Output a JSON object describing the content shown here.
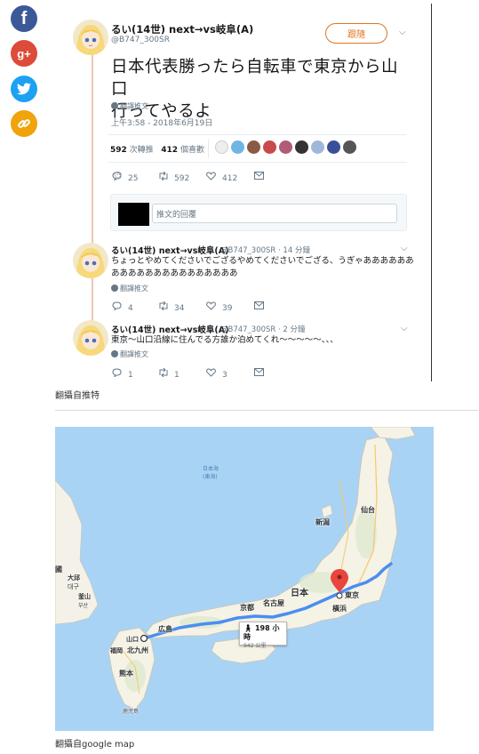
{
  "share": {
    "facebook_label": "f",
    "googleplus_label": "g+"
  },
  "tweet": {
    "display_name": "るい(14世) next→vs岐阜(A)",
    "handle": "@B747_300SR",
    "follow_label": "跟隨",
    "text_line1": "日本代表勝ったら自転車で東京から山口",
    "text_line2": "行ってやるよ",
    "translate_label": "翻譯推文",
    "timestamp": "上午3:58 - 2018年6月19日",
    "retweets_count": "592",
    "retweets_label": "次轉推",
    "likes_count": "412",
    "likes_label": "個喜歡",
    "reply_count": "25",
    "retweet_action_count": "592",
    "like_action_count": "412",
    "reply_placeholder": "推文的回覆"
  },
  "replies": [
    {
      "display_name": "るい(14世) next→vs岐阜(A)",
      "handle_time": "@B747_300SR · 14 分鐘",
      "text": "ちょっとやめてくださいでござるやめてくださいでござる、うぎゃあああああああああああああああああああああ",
      "translate_label": "翻譯推文",
      "reply_count": "4",
      "retweet_count": "34",
      "like_count": "39"
    },
    {
      "display_name": "るい(14世) next→vs岐阜(A)",
      "handle_time": "@B747_300SR · 2 分鐘",
      "text": "東京～山口沿線に住んでる方誰か泊めてくれ～～～～～、、、",
      "translate_label": "翻譯推文",
      "reply_count": "1",
      "retweet_count": "1",
      "like_count": "3"
    }
  ],
  "captions": {
    "twitter": "翻攝自推特",
    "map": "翻攝自google map"
  },
  "map": {
    "sea_jp": "日本海",
    "sea_kr": "(東海)",
    "korea": "國",
    "daegu": "大邱",
    "daegu_kr": "대구",
    "busan": "釜山",
    "busan_kr": "부산",
    "japan": "日本",
    "sendai": "仙台",
    "niigata": "新潟",
    "nagoya": "名古屋",
    "kyoto": "京都",
    "tokyo": "東京",
    "yokohama": "橫浜",
    "hiroshima": "広島",
    "yamaguchi": "山口",
    "fukuoka": "福岡",
    "kitakyushu": "北九州",
    "kumamoto": "熊本",
    "kagoshima": "鹿児島",
    "route_time": "198 小時",
    "route_distance": "942 公里"
  },
  "colors": {
    "accent": "#e0741f",
    "route": "#4a8ef0",
    "marker": "#e8453c",
    "facebook": "#3b5998",
    "googleplus": "#dd4b39",
    "twitter": "#1da1f2",
    "link": "#f0a30a"
  }
}
